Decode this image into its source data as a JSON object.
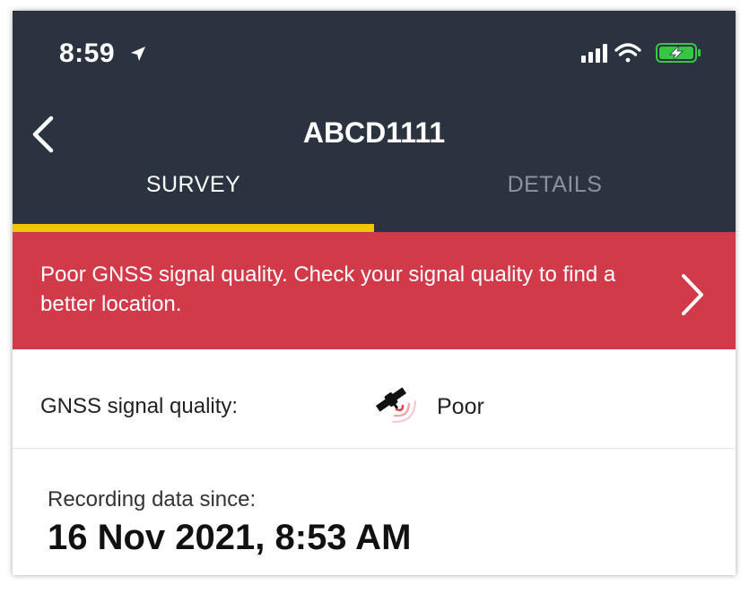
{
  "status_bar": {
    "time": "8:59",
    "location_icon": "location-arrow-icon",
    "signal_icon": "cellular-signal-icon",
    "wifi_icon": "wifi-icon",
    "battery_icon": "battery-charging-icon",
    "battery_color": "#38c645"
  },
  "nav": {
    "back_icon": "chevron-left-icon",
    "title": "ABCD1111"
  },
  "tabs": [
    {
      "label": "SURVEY",
      "active": true
    },
    {
      "label": "DETAILS",
      "active": false
    }
  ],
  "colors": {
    "header_bg": "#2c3340",
    "tab_indicator": "#f2c500",
    "alert_bg": "#d13a49"
  },
  "alert": {
    "message": "Poor GNSS signal quality. Check your signal quality to find a better location.",
    "chevron_icon": "chevron-right-icon"
  },
  "gnss": {
    "label": "GNSS signal quality:",
    "icon": "satellite-poor-signal-icon",
    "value": "Poor"
  },
  "recording": {
    "label": "Recording data since:",
    "value": "16 Nov 2021, 8:53 AM"
  }
}
